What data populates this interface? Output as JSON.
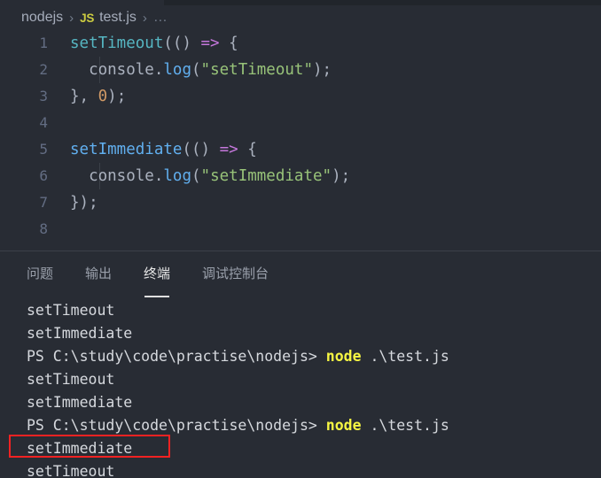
{
  "window": {
    "theme_bg": "#282c34",
    "tab_bar_bg": "#21252b"
  },
  "breadcrumb": {
    "folder": "nodejs",
    "separator": "›",
    "file_icon_label": "JS",
    "file": "test.js",
    "ellipsis": "…"
  },
  "editor": {
    "language": "javascript",
    "lines": [
      {
        "number": "1",
        "text": "setTimeout(() => {",
        "tokens": [
          {
            "t": "setTimeout",
            "c": "t-fn-teal"
          },
          {
            "t": "(()",
            "c": "t-punct"
          },
          {
            "t": " ",
            "c": "t-punct"
          },
          {
            "t": "=>",
            "c": "t-arrow"
          },
          {
            "t": " {",
            "c": "t-punct"
          }
        ],
        "indent_guide": false
      },
      {
        "number": "2",
        "text": "  console.log(\"setTimeout\");",
        "tokens": [
          {
            "t": "  ",
            "c": "t-punct"
          },
          {
            "t": "console",
            "c": "t-var"
          },
          {
            "t": ".",
            "c": "t-punct"
          },
          {
            "t": "log",
            "c": "t-method"
          },
          {
            "t": "(",
            "c": "t-punct"
          },
          {
            "t": "\"setTimeout\"",
            "c": "t-string"
          },
          {
            "t": ");",
            "c": "t-punct"
          }
        ],
        "indent_guide": true
      },
      {
        "number": "3",
        "text": "}, 0);",
        "tokens": [
          {
            "t": "}, ",
            "c": "t-punct"
          },
          {
            "t": "0",
            "c": "t-num"
          },
          {
            "t": ");",
            "c": "t-punct"
          }
        ],
        "indent_guide": false
      },
      {
        "number": "4",
        "text": "",
        "tokens": [],
        "indent_guide": false
      },
      {
        "number": "5",
        "text": "setImmediate(() => {",
        "tokens": [
          {
            "t": "setImmediate",
            "c": "t-fn-blue"
          },
          {
            "t": "(()",
            "c": "t-punct"
          },
          {
            "t": " ",
            "c": "t-punct"
          },
          {
            "t": "=>",
            "c": "t-arrow"
          },
          {
            "t": " {",
            "c": "t-punct"
          }
        ],
        "indent_guide": false
      },
      {
        "number": "6",
        "text": "  console.log(\"setImmediate\");",
        "tokens": [
          {
            "t": "  ",
            "c": "t-punct"
          },
          {
            "t": "console",
            "c": "t-var"
          },
          {
            "t": ".",
            "c": "t-punct"
          },
          {
            "t": "log",
            "c": "t-method"
          },
          {
            "t": "(",
            "c": "t-punct"
          },
          {
            "t": "\"setImmediate\"",
            "c": "t-string"
          },
          {
            "t": ");",
            "c": "t-punct"
          }
        ],
        "indent_guide": true
      },
      {
        "number": "7",
        "text": "});",
        "tokens": [
          {
            "t": "});",
            "c": "t-punct"
          }
        ],
        "indent_guide": false
      },
      {
        "number": "8",
        "text": "",
        "tokens": [],
        "indent_guide": false
      }
    ]
  },
  "panel": {
    "tabs": [
      {
        "label": "问题",
        "active": false
      },
      {
        "label": "输出",
        "active": false
      },
      {
        "label": "终端",
        "active": true
      },
      {
        "label": "调试控制台",
        "active": false
      }
    ],
    "terminal": {
      "prompt_prefix": "PS C:\\study\\code\\practise\\nodejs>",
      "command_keyword": "node",
      "command_arg": ".\\test.js",
      "lines": [
        {
          "type": "output",
          "text": "setTimeout"
        },
        {
          "type": "output",
          "text": "setImmediate"
        },
        {
          "type": "prompt",
          "prefix": "PS C:\\study\\code\\practise\\nodejs> ",
          "keyword": "node",
          "arg": " .\\test.js"
        },
        {
          "type": "output",
          "text": "setTimeout"
        },
        {
          "type": "output",
          "text": "setImmediate"
        },
        {
          "type": "prompt",
          "prefix": "PS C:\\study\\code\\practise\\nodejs> ",
          "keyword": "node",
          "arg": " .\\test.js"
        },
        {
          "type": "output",
          "text": "setImmediate",
          "highlighted": true
        },
        {
          "type": "output",
          "text": "setTimeout"
        }
      ]
    }
  },
  "annotation": {
    "color": "#f42222",
    "target_text": "setImmediate"
  }
}
